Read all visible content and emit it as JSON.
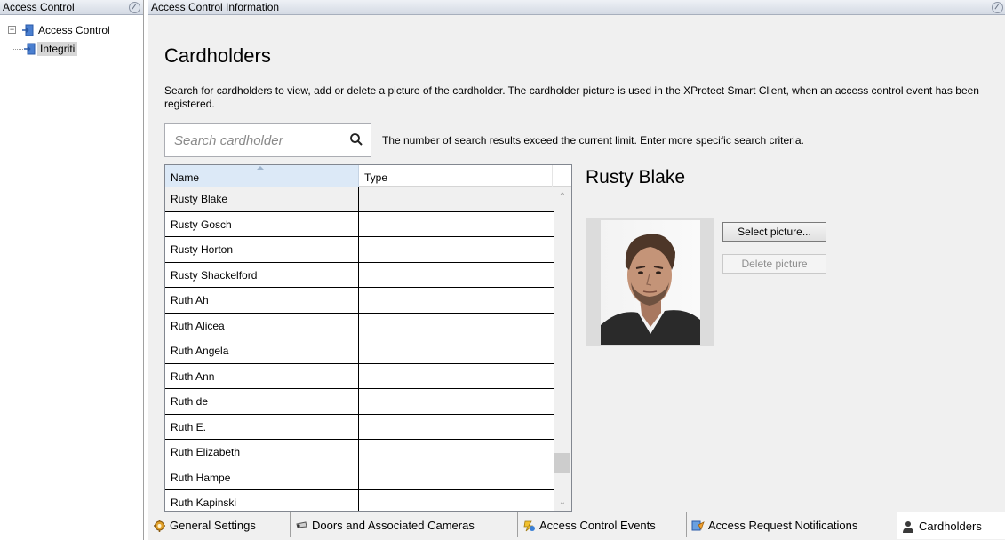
{
  "left_pane": {
    "title": "Access Control",
    "tree": {
      "root_label": "Access Control",
      "child_label": "Integriti"
    }
  },
  "main_pane": {
    "title": "Access Control Information",
    "page_title": "Cardholders",
    "description": "Search for cardholders to view, add or delete a picture of the cardholder. The cardholder picture is used in the XProtect Smart Client, when an access control event has been registered.",
    "search": {
      "placeholder": "Search cardholder",
      "value": ""
    },
    "search_notice": "The number of search results exceed the current limit. Enter more specific search criteria.",
    "grid": {
      "columns": [
        "Name",
        "Type"
      ],
      "sorted_column": "Name",
      "rows": [
        {
          "name": "Rusty Blake",
          "type": ""
        },
        {
          "name": "Rusty Gosch",
          "type": ""
        },
        {
          "name": "Rusty Horton",
          "type": ""
        },
        {
          "name": "Rusty Shackelford",
          "type": ""
        },
        {
          "name": "Ruth Ah",
          "type": ""
        },
        {
          "name": "Ruth Alicea",
          "type": ""
        },
        {
          "name": "Ruth Angela",
          "type": ""
        },
        {
          "name": "Ruth Ann",
          "type": ""
        },
        {
          "name": "Ruth de",
          "type": ""
        },
        {
          "name": "Ruth E.",
          "type": ""
        },
        {
          "name": "Ruth Elizabeth",
          "type": ""
        },
        {
          "name": "Ruth Hampe",
          "type": ""
        },
        {
          "name": "Ruth Kapinski",
          "type": ""
        }
      ],
      "selected_index": 0
    },
    "detail": {
      "name": "Rusty Blake",
      "select_picture_label": "Select picture...",
      "delete_picture_label": "Delete picture",
      "delete_enabled": false
    }
  },
  "tabs": [
    {
      "label": "General Settings",
      "icon": "gear-icon",
      "active": false
    },
    {
      "label": "Doors and Associated Cameras",
      "icon": "camera-icon",
      "active": false
    },
    {
      "label": "Access Control Events",
      "icon": "event-icon",
      "active": false
    },
    {
      "label": "Access Request Notifications",
      "icon": "notification-icon",
      "active": false
    },
    {
      "label": "Cardholders",
      "icon": "person-icon",
      "active": true
    }
  ],
  "colors": {
    "header_gradient_top": "#eef1f6",
    "header_gradient_bottom": "#d4dae4",
    "panel_bg": "#f0f0f0",
    "sorted_column_bg": "#dce9f7"
  }
}
